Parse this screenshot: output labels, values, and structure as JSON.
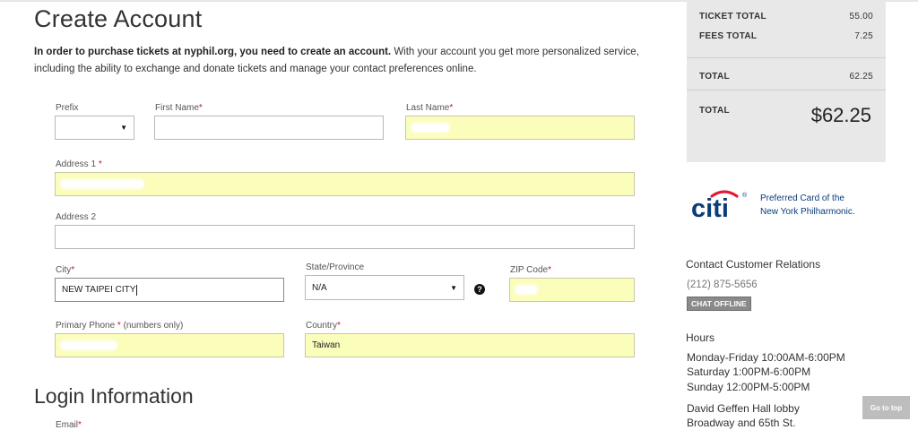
{
  "page": {
    "title": "Create Account"
  },
  "intro": {
    "bold": "In order to purchase tickets at nyphil.org, you need to create an account.",
    "text": " With your account you get more personalized service, including the ability to exchange and donate tickets and manage your contact preferences online."
  },
  "form": {
    "prefix": {
      "label": "Prefix",
      "value": ""
    },
    "first_name": {
      "label": "First Name",
      "required": "*"
    },
    "last_name": {
      "label": "Last Name",
      "required": "*"
    },
    "address1": {
      "label": "Address 1 ",
      "required": "*"
    },
    "address2": {
      "label": "Address 2",
      "value": ""
    },
    "city": {
      "label": "City",
      "required": "*",
      "value": "NEW TAIPEI CITY"
    },
    "state": {
      "label": "State/Province",
      "value": "N/A"
    },
    "state_help": "?",
    "zip": {
      "label": "ZIP Code",
      "required": "*"
    },
    "phone": {
      "label": "Primary Phone ",
      "required": "*",
      "hint": " (numbers only)"
    },
    "country": {
      "label": "Country",
      "required": "*",
      "value": "Taiwan"
    }
  },
  "login": {
    "title": "Login Information",
    "email_label": "Email",
    "required": "*"
  },
  "summary": {
    "ticket_total_label": "TICKET TOTAL",
    "ticket_total": "55.00",
    "fees_total_label": "FEES TOTAL",
    "fees_total": "7.25",
    "total_label": "TOTAL",
    "total": "62.25",
    "grand_total_label": "TOTAL",
    "grand_total": "$62.25"
  },
  "sponsor": {
    "logo": "citi",
    "line1": "Preferred Card of the",
    "line2": "New York Philharmonic."
  },
  "contact": {
    "heading": "Contact Customer Relations",
    "phone": "(212) 875-5656",
    "chat": "CHAT OFFLINE"
  },
  "hours": {
    "heading": "Hours",
    "lines": [
      "Monday-Friday 10:00AM-6:00PM",
      "Saturday 1:00PM-6:00PM",
      "Sunday 12:00PM-5:00PM",
      "David Geffen Hall lobby",
      "Broadway and 65th St."
    ]
  },
  "go_top": "Go to top",
  "colors": {
    "autofill": "#fbfdbb",
    "required": "#c8102e",
    "citi_blue": "#0a3b7a",
    "citi_red": "#e31837"
  },
  "icons": {
    "prefix_dropdown": "caret-down-icon",
    "state_dropdown": "caret-down-icon",
    "help": "help-icon"
  }
}
